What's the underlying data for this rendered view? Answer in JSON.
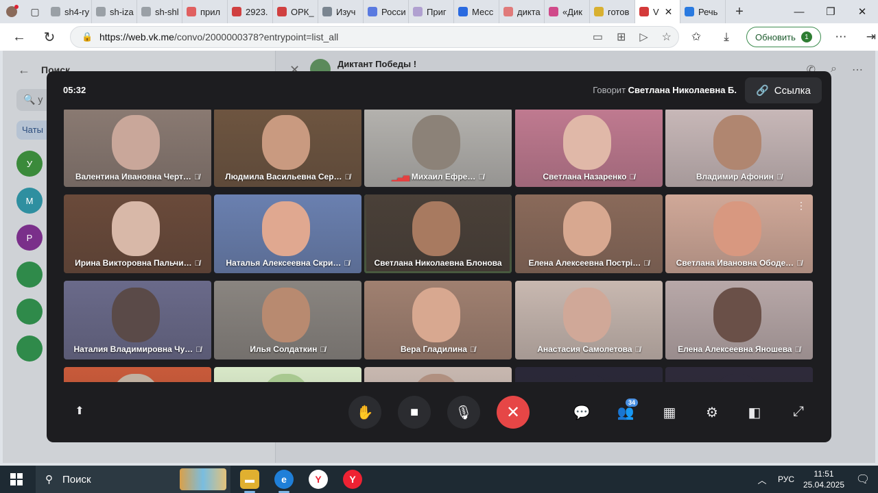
{
  "browser": {
    "tabs": [
      {
        "label": "sh4-ry",
        "color": "#9aa0a6"
      },
      {
        "label": "sh-iza",
        "color": "#9aa0a6"
      },
      {
        "label": "sh-shl",
        "color": "#9aa0a6"
      },
      {
        "label": "прил",
        "color": "#e06060"
      },
      {
        "label": "2923.",
        "color": "#d04040"
      },
      {
        "label": "ОРК_",
        "color": "#d04040"
      },
      {
        "label": "Изуч",
        "color": "#7a8590"
      },
      {
        "label": "Росси",
        "color": "#5a7ae0"
      },
      {
        "label": "Приг",
        "color": "#b0a0d0"
      },
      {
        "label": "Месс",
        "color": "#2a6ae0"
      },
      {
        "label": "дикта",
        "color": "#e07a7a"
      },
      {
        "label": "«Дик",
        "color": "#d04a8a"
      },
      {
        "label": "готов",
        "color": "#d8b030"
      },
      {
        "label": "V",
        "color": "#d43a3a"
      },
      {
        "label": "Речь",
        "color": "#2a7ae0"
      }
    ],
    "address": {
      "url_host": "https://web.vk.me",
      "url_path": "/convo/2000000378?entrypoint=list_all"
    },
    "update_label": "Обновить"
  },
  "vk": {
    "search_title": "Поиск",
    "search_value": "у",
    "chats_tab": "Чаты",
    "chat_title": "Диктант Победы !",
    "avatars": [
      {
        "letter": "У",
        "color": "#3b8a3b"
      },
      {
        "letter": "М",
        "color": "#2f8fa0"
      },
      {
        "letter": "Р",
        "color": "#7a2f8a"
      },
      {
        "letter": "",
        "color": "#2f8a4a"
      },
      {
        "letter": "",
        "color": "#2f8a4a"
      },
      {
        "letter": "",
        "color": "#2f8a4a"
      }
    ]
  },
  "call": {
    "timer": "05:32",
    "speaking_prefix": "Говорит",
    "speaking_name": "Светлана Николаевна Б.",
    "link_label": "Ссылка",
    "participants_count": "34",
    "participants": [
      {
        "name": "Валентина Ивановна Черт…",
        "bg": "#8a7a72",
        "face": "#c9a79a",
        "muted": true
      },
      {
        "name": "Людмила Васильевна Сер…",
        "bg": "#6e5540",
        "face": "#c99a80",
        "muted": true
      },
      {
        "name": "Михаил Ефре…",
        "bg": "#b4b2ae",
        "face": "#8c8278",
        "muted": true,
        "signal": true
      },
      {
        "name": "Светлана Назаренко",
        "bg": "#c07a90",
        "face": "#e0b8a8",
        "muted": true
      },
      {
        "name": "Владимир Афонин",
        "bg": "#c8b8b8",
        "face": "#b08670",
        "muted": true
      },
      {
        "name": "Ирина Викторовна Пальчи…",
        "bg": "#6a4a3a",
        "face": "#d8b8a8",
        "muted": true
      },
      {
        "name": "Наталья Алексеевна Скри…",
        "bg": "#6a80b0",
        "face": "#e0a890",
        "muted": true
      },
      {
        "name": "Светлана Николаевна Блонова",
        "bg": "#4a4038",
        "face": "#a87a60",
        "muted": false,
        "speaker": true
      },
      {
        "name": "Елена Алексеевна Пострі…",
        "bg": "#8a6a5a",
        "face": "#d8a890",
        "muted": true
      },
      {
        "name": "Светлана Ивановна Ободе…",
        "bg": "#d0a898",
        "face": "#d89880",
        "muted": true,
        "kebab": true
      },
      {
        "name": "Наталия Владимировна Чу…",
        "bg": "#6a6a8a",
        "face": "#5a4a48",
        "muted": true
      },
      {
        "name": "Илья Солдаткин",
        "bg": "#8a8580",
        "face": "#b88a70",
        "muted": true
      },
      {
        "name": "Вера Гладилина",
        "bg": "#a08070",
        "face": "#d8a890",
        "muted": true
      },
      {
        "name": "Анастасия Самолетова",
        "bg": "#c8b8b0",
        "face": "#d0a898",
        "muted": true
      },
      {
        "name": "Елена Алексеевна Яношева",
        "bg": "#b8a8a8",
        "face": "#6a5048",
        "muted": true
      },
      {
        "name": "",
        "bg": "#c85a3a",
        "face": "#c0b0a0",
        "muted": false
      },
      {
        "name": "",
        "bg": "#d8e8c8",
        "face": "#a8c890",
        "muted": false
      },
      {
        "name": "",
        "bg": "#c8b8b0",
        "face": "#b09080",
        "muted": false
      },
      {
        "name": "",
        "bg": "#2a2838",
        "face": "#2a2838",
        "muted": false
      },
      {
        "name": "",
        "bg": "#2e2a3a",
        "face": "#2e2a3a",
        "muted": false
      }
    ]
  },
  "taskbar": {
    "search_label": "Поиск",
    "lang": "РУС",
    "time": "11:51",
    "date": "25.04.2025"
  }
}
